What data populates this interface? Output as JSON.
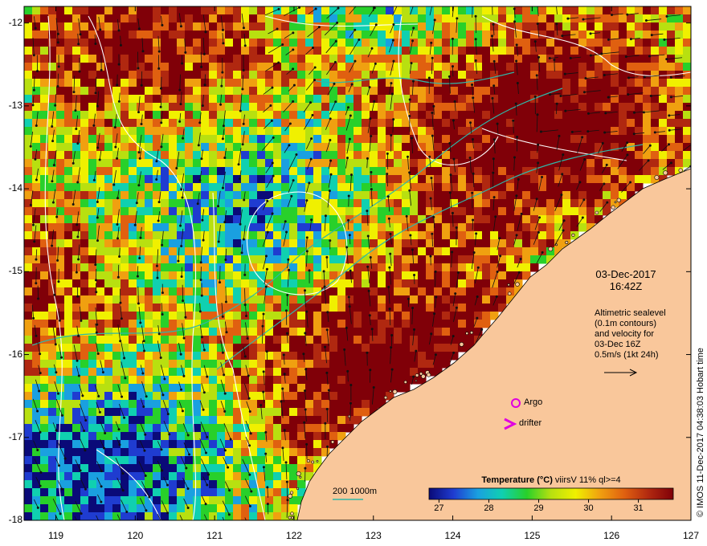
{
  "map": {
    "bounds": {
      "lon_min": 118.6,
      "lon_max": 127.0,
      "lat_min": -18.0,
      "lat_max": -11.8
    },
    "x_ticks": [
      "119",
      "120",
      "121",
      "122",
      "123",
      "124",
      "125",
      "126",
      "127"
    ],
    "y_ticks": [
      "-12",
      "-13",
      "-14",
      "-15",
      "-16",
      "-17",
      "-18"
    ],
    "land_color": "#f9c79b",
    "contour_color": "#ffffff",
    "bathy_color": "#2fb8a8"
  },
  "timestamp": {
    "date": "03-Dec-2017",
    "time": "16:42Z"
  },
  "altimetry": {
    "line1": "Altimetric sealevel",
    "line2": "(0.1m contours)",
    "line3": "and velocity for",
    "line4": "03-Dec 16Z",
    "line5": "0.5m/s (1kt 24h)"
  },
  "markers": {
    "argo_label": "Argo",
    "argo_color": "#e000e0",
    "drifter_label": "drifter",
    "drifter_color": "#e000e0"
  },
  "bathymetry": {
    "label": "200  1000m"
  },
  "legend": {
    "title": "Temperature (°C)",
    "title_tail": " viirsV 11% ql>=4",
    "ticks": [
      "27",
      "28",
      "29",
      "30",
      "31"
    ],
    "colors": [
      "#0a0a78",
      "#1f3cd0",
      "#1aa0e0",
      "#10d0b0",
      "#28d02a",
      "#b8e010",
      "#f0f000",
      "#f0a010",
      "#e06010",
      "#b02810",
      "#800008"
    ]
  },
  "credit": "© IMOS 11-Dec-2017 04:38:03 Hobart time"
}
